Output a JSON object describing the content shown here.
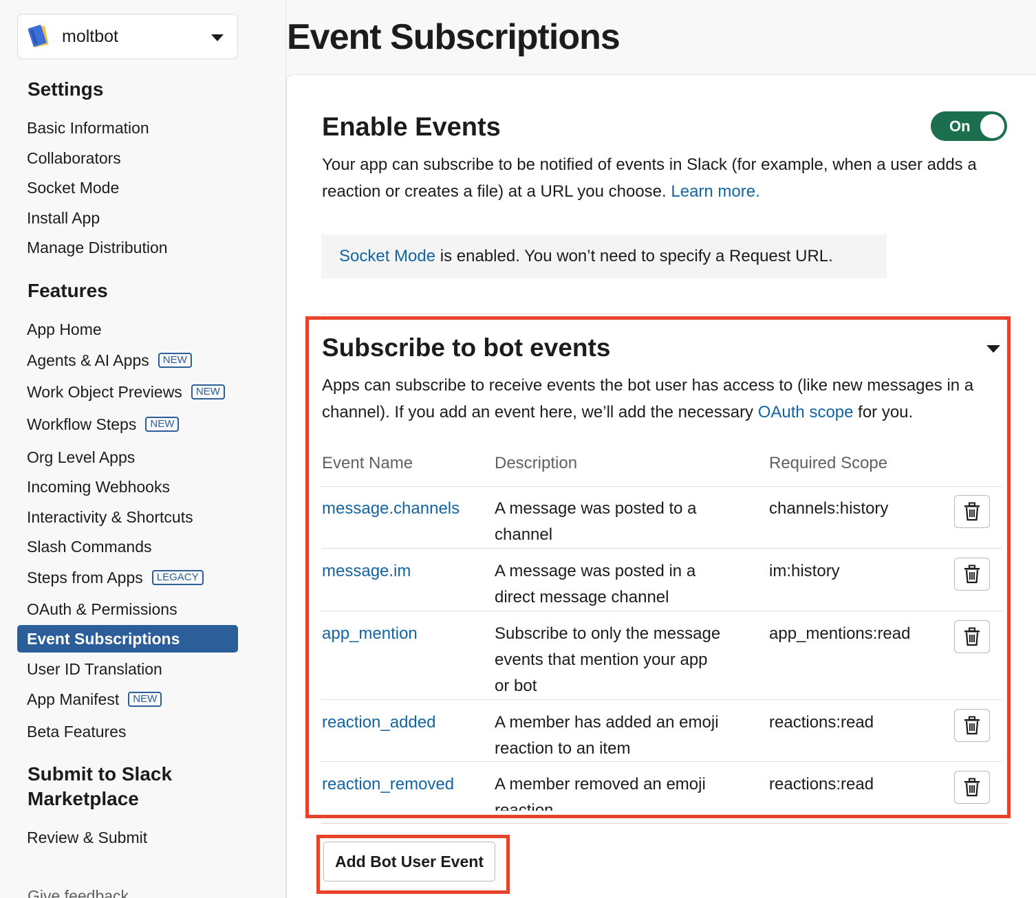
{
  "app": {
    "name": "moltbot"
  },
  "page": {
    "title": "Event Subscriptions"
  },
  "sidebar": {
    "settings_heading": "Settings",
    "settings_items": [
      {
        "label": "Basic Information"
      },
      {
        "label": "Collaborators"
      },
      {
        "label": "Socket Mode"
      },
      {
        "label": "Install App"
      },
      {
        "label": "Manage Distribution"
      }
    ],
    "features_heading": "Features",
    "features_items": [
      {
        "label": "App Home",
        "badge": ""
      },
      {
        "label": "Agents & AI Apps",
        "badge": "NEW"
      },
      {
        "label": "Work Object Previews",
        "badge": "NEW"
      },
      {
        "label": "Workflow Steps",
        "badge": "NEW"
      },
      {
        "label": "Org Level Apps",
        "badge": ""
      },
      {
        "label": "Incoming Webhooks",
        "badge": ""
      },
      {
        "label": "Interactivity & Shortcuts",
        "badge": ""
      },
      {
        "label": "Slash Commands",
        "badge": ""
      },
      {
        "label": "Steps from Apps",
        "badge": "LEGACY"
      },
      {
        "label": "OAuth & Permissions",
        "badge": ""
      },
      {
        "label": "Event Subscriptions",
        "badge": "",
        "active": true
      },
      {
        "label": "User ID Translation",
        "badge": ""
      },
      {
        "label": "App Manifest",
        "badge": "NEW"
      },
      {
        "label": "Beta Features",
        "badge": ""
      }
    ],
    "submit_heading_line1": "Submit to Slack",
    "submit_heading_line2": "Marketplace",
    "submit_items": [
      {
        "label": "Review & Submit"
      }
    ],
    "feedback": "Give feedback"
  },
  "enable_events": {
    "heading": "Enable Events",
    "toggle_label": "On",
    "toggle_on": true,
    "description_line1": "Your app can subscribe to be notified of events in Slack (for example, when a user adds a",
    "description_line2": "reaction or creates a file) at a URL you choose. ",
    "learn_more": "Learn more.",
    "socket_link": "Socket Mode",
    "socket_text": " is enabled. You won’t need to specify a Request URL."
  },
  "bot_events": {
    "heading": "Subscribe to bot events",
    "description_line1": "Apps can subscribe to receive events the bot user has access to (like new messages in a",
    "description_line2_a": "channel). If you add an event here, we’ll add the necessary ",
    "oauth_link": "OAuth scope",
    "description_line2_b": " for you.",
    "columns": {
      "event_name": "Event Name",
      "description": "Description",
      "required_scope": "Required Scope"
    },
    "rows": [
      {
        "event": "message.channels",
        "desc_lines": [
          "A message was posted to a",
          "channel"
        ],
        "scope": "channels:history"
      },
      {
        "event": "message.im",
        "desc_lines": [
          "A message was posted in a",
          "direct message channel"
        ],
        "scope": "im:history"
      },
      {
        "event": "app_mention",
        "desc_lines": [
          "Subscribe to only the message",
          "events that mention your app",
          "or bot"
        ],
        "scope": "app_mentions:read"
      },
      {
        "event": "reaction_added",
        "desc_lines": [
          "A member has added an emoji",
          "reaction to an item"
        ],
        "scope": "reactions:read"
      },
      {
        "event": "reaction_removed",
        "desc_lines": [
          "A member removed an emoji",
          "reaction"
        ],
        "scope": "reactions:read"
      }
    ],
    "add_button": "Add Bot User Event"
  },
  "colors": {
    "accent": "#2c5e99",
    "link": "#1264a3",
    "toggle": "#1b6f4e",
    "highlight": "#e8412c"
  }
}
